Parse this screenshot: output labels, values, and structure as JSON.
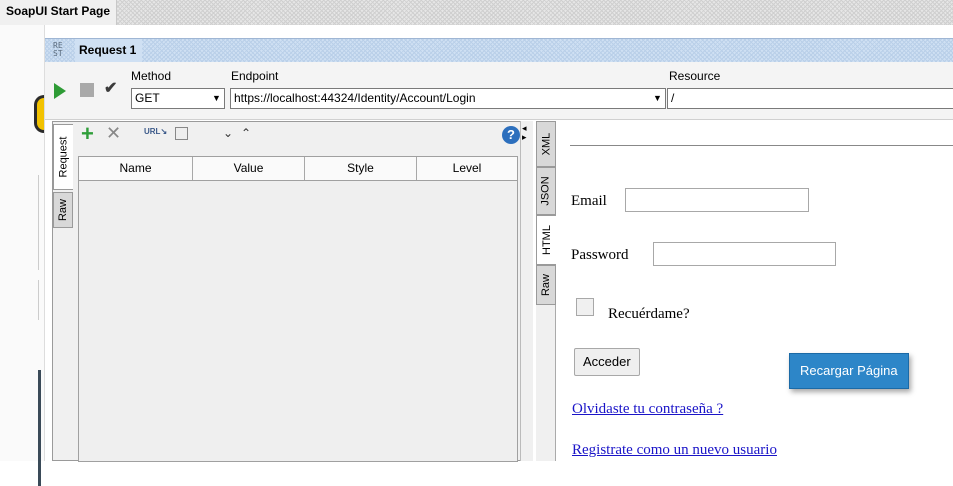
{
  "start_page": {
    "title": "SoapUI Start Page"
  },
  "request_window": {
    "icon": "rest-icon",
    "icon_text": "RE ST",
    "title": "Request 1"
  },
  "toolbar": {
    "method_label": "Method",
    "method_value": "GET",
    "endpoint_label": "Endpoint",
    "endpoint_value": "https://localhost:44324/Identity/Account/Login",
    "resource_label": "Resource",
    "resource_value": "/"
  },
  "request_panel": {
    "tabs": [
      "Request",
      "Raw"
    ],
    "columns": [
      "Name",
      "Value",
      "Style",
      "Level"
    ],
    "rows": []
  },
  "response_panel": {
    "tabs": [
      "XML",
      "JSON",
      "HTML",
      "Raw"
    ],
    "active_tab": "HTML",
    "form": {
      "email_label": "Email",
      "email_value": "",
      "password_label": "Password",
      "password_value": "",
      "remember_label": "Recuérdame?",
      "remember_checked": false,
      "submit_label": "Acceder",
      "forgot_link": "Olvidaste tu contraseña ?",
      "register_link": "Registrate como un nuevo usuario"
    },
    "tooltip": "Recargar Página"
  },
  "colors": {
    "accent_blue": "#2d86c8",
    "play_green": "#2e9b35",
    "link": "#1a14c8"
  }
}
